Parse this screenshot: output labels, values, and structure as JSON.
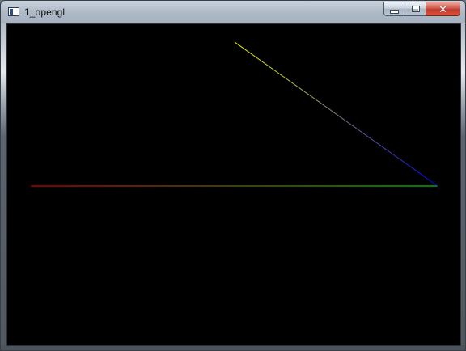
{
  "window": {
    "title": "1_opengl",
    "minimize_icon": "minimize-icon",
    "maximize_icon": "maximize-icon",
    "close_icon": "close-icon",
    "close_glyph": "✕"
  },
  "canvas": {
    "background": "#000000",
    "line_colors": {
      "red": "#ff0000",
      "green": "#00ff00",
      "blue": "#0000ff",
      "yellow": "#ffff00"
    }
  }
}
